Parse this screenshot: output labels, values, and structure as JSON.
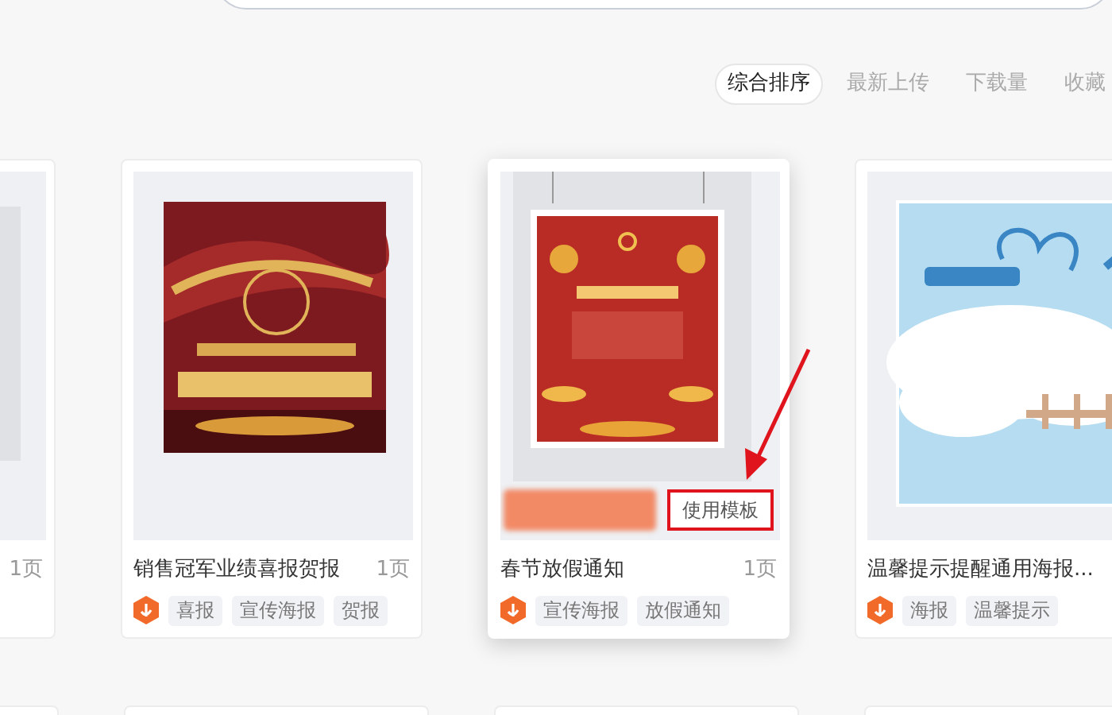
{
  "sort_tabs": [
    {
      "label": "综合排序",
      "selected": true
    },
    {
      "label": "最新上传",
      "selected": false
    },
    {
      "label": "下载量",
      "selected": false
    },
    {
      "label": "收藏",
      "selected": false
    }
  ],
  "cards": [
    {
      "pages": "1页",
      "hovered": false,
      "preview": {
        "kind": "picture"
      }
    },
    {
      "title": "销售冠军业绩喜报贺报",
      "pages": "1页",
      "hovered": false,
      "preview": {
        "kind": "picture"
      },
      "tags": [
        "喜报",
        "宣传海报",
        "贺报"
      ]
    },
    {
      "title": "春节放假通知",
      "pages": "1页",
      "hovered": true,
      "action_label": "使用模板",
      "annotated": true,
      "preview": {
        "kind": "picture"
      },
      "tags": [
        "宣传海报",
        "放假通知"
      ]
    },
    {
      "title": "温馨提示提醒通用海报...",
      "hovered": false,
      "preview": {
        "kind": "picture"
      },
      "tags": [
        "海报",
        "温馨提示"
      ]
    }
  ]
}
